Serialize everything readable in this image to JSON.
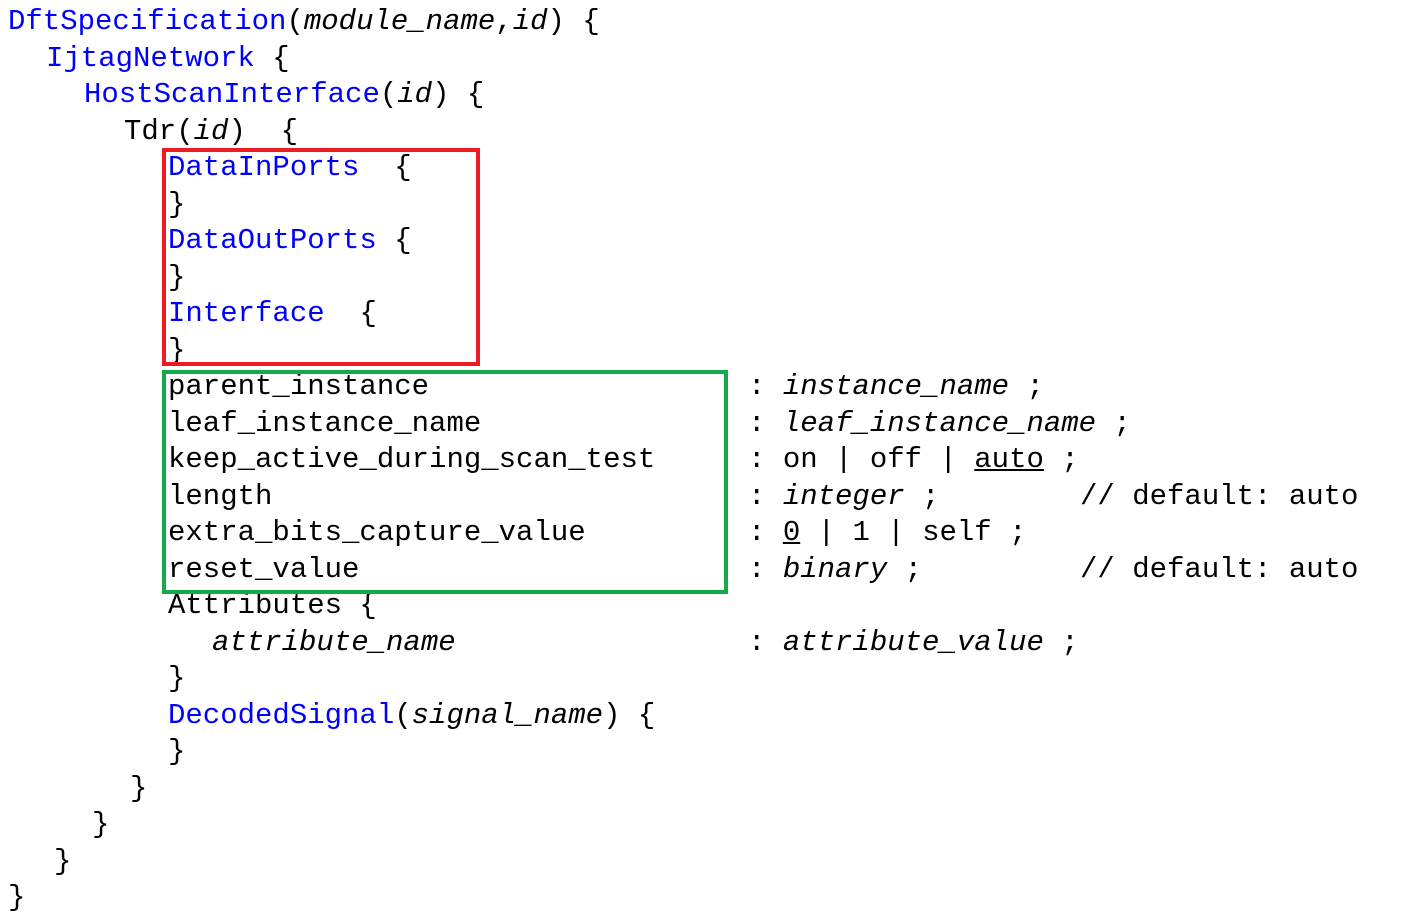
{
  "document": {
    "title": "DftSpecification Tdr syntax",
    "language": "dft-specification",
    "font_colors": {
      "keyword": "#0000FF",
      "text": "#000000",
      "background": "#FFFFFF",
      "highlight_red": "#EE1B24",
      "highlight_green": "#16A84A"
    }
  },
  "code": {
    "lines": [
      {
        "indent": 0,
        "keyword": "DftSpecification",
        "params": "(module_name,id)",
        "brace": " {"
      },
      {
        "indent": 1,
        "keyword": "IjtagNetwork",
        "params": "",
        "brace": " {"
      },
      {
        "indent": 2,
        "keyword": "HostScanInterface",
        "params": "(id)",
        "brace": " {"
      },
      {
        "indent": 3,
        "keyword": "Tdr",
        "params": "(id)",
        "brace": " {"
      },
      {
        "indent": 4,
        "keyword": "DataInPorts",
        "params": "",
        "brace": "  {"
      },
      {
        "indent": 4,
        "keyword": "",
        "params": "",
        "brace": "}"
      },
      {
        "indent": 4,
        "keyword": "DataOutPorts",
        "params": "",
        "brace": " {"
      },
      {
        "indent": 4,
        "keyword": "",
        "params": "",
        "brace": "}"
      },
      {
        "indent": 4,
        "keyword": "Interface",
        "params": "",
        "brace": "  {"
      },
      {
        "indent": 4,
        "keyword": "",
        "params": "",
        "brace": "}"
      }
    ],
    "keyword_blocks": [
      "DftSpecification",
      "IjtagNetwork",
      "HostScanInterface",
      "DataInPorts",
      "DataOutPorts",
      "Interface",
      "DecodedSignal"
    ],
    "line_texts": {
      "l1_name": "DftSpecification",
      "l1_args": "(",
      "l1_arg1": "module_name",
      "l1_comma": ",",
      "l1_arg2": "id",
      "l1_close": ") {",
      "l2_name": "IjtagNetwork",
      "l2_brace": " {",
      "l3_name": "HostScanInterface",
      "l3_open": "(",
      "l3_arg": "id",
      "l3_close": ") {",
      "l4_name": "Tdr",
      "l4_open": "(",
      "l4_arg": "id",
      "l4_close": ")  {",
      "l5_name": "DataInPorts",
      "l5_brace": "  {",
      "l6_brace": "}",
      "l7_name": "DataOutPorts",
      "l7_brace": " {",
      "l8_brace": "}",
      "l9_name": "Interface",
      "l9_brace": "  {",
      "l10_brace": "}",
      "l17_name": "Attributes",
      "l17_brace": " {",
      "l18_name": "attribute_name",
      "l19_brace": "}",
      "l20_name": "DecodedSignal",
      "l20_open": "(",
      "l20_arg": "signal_name",
      "l20_close": ") {",
      "l21_brace": "}",
      "l22_brace": "}",
      "l23_brace": "}",
      "l24_brace": "}",
      "l25_brace": "}"
    },
    "properties": [
      {
        "name": "parent_instance",
        "colon": ":",
        "value_italic": "instance_name",
        "value_plain": "",
        "terminator": ";",
        "comment": ""
      },
      {
        "name": "leaf_instance_name",
        "colon": ":",
        "value_italic": "leaf_instance_name",
        "value_plain": "",
        "terminator": ";",
        "comment": ""
      },
      {
        "name": "keep_active_during_scan_test",
        "colon": ":",
        "value_italic": "",
        "value_plain": "on | off | auto",
        "value_default": "auto",
        "terminator": ";",
        "comment": ""
      },
      {
        "name": "length",
        "colon": ":",
        "value_italic": "integer",
        "value_plain": "",
        "terminator": ";",
        "comment": "// default: auto"
      },
      {
        "name": "extra_bits_capture_value",
        "colon": ":",
        "value_italic": "",
        "value_plain": "0 | 1 | self",
        "value_default": "0",
        "terminator": ";",
        "comment": ""
      },
      {
        "name": "reset_value",
        "colon": ":",
        "value_italic": "binary",
        "value_plain": "",
        "terminator": ";",
        "comment": "// default: auto"
      }
    ],
    "attribute_row": {
      "name": "attribute_name",
      "colon": ":",
      "value": "attribute_value",
      "terminator": ";"
    },
    "value_fragments": {
      "p1_colon": ":",
      "p1_val": "instance_name",
      "p1_end": ";",
      "p2_colon": ":",
      "p2_val": "leaf_instance_name",
      "p2_end": ";",
      "p3_colon": ":",
      "p3_on": "on",
      "p3_bar1": "|",
      "p3_off": "off",
      "p3_bar2": "|",
      "p3_auto": "auto",
      "p3_end": ";",
      "p4_colon": ":",
      "p4_val": "integer",
      "p4_end": ";",
      "p4_comment": "// default: auto",
      "p5_colon": ":",
      "p5_zero": "0",
      "p5_bar1": "|",
      "p5_one": "1",
      "p5_bar2": "|",
      "p5_self": "self",
      "p5_end": ";",
      "p6_colon": ":",
      "p6_val": "binary",
      "p6_end": ";",
      "p6_comment": "// default: auto",
      "attr_colon": ":",
      "attr_val": "attribute_value",
      "attr_end": ";"
    }
  },
  "annotations": {
    "red_box": {
      "label": "ports-and-interface-highlight",
      "color": "#EE1B24",
      "contains": [
        "DataInPorts",
        "DataOutPorts",
        "Interface"
      ]
    },
    "green_box": {
      "label": "tdr-properties-highlight",
      "color": "#16A84A",
      "contains": [
        "parent_instance",
        "leaf_instance_name",
        "keep_active_during_scan_test",
        "length",
        "extra_bits_capture_value",
        "reset_value"
      ]
    }
  }
}
